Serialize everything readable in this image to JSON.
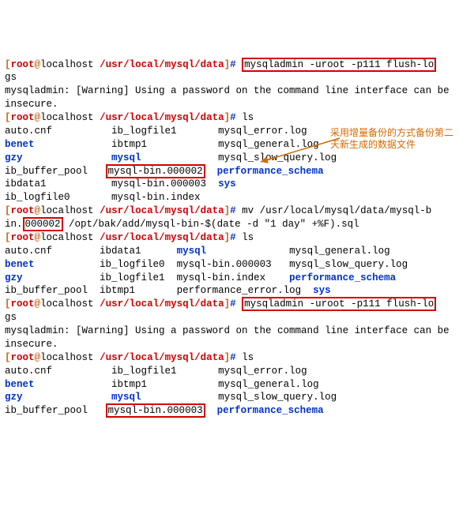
{
  "prompt": {
    "lb": "[",
    "rb": "]",
    "user": "root",
    "at": "@",
    "host": "localhost",
    "path": "/usr/local/mysql/data",
    "hash": "#"
  },
  "cmd1": "mysqladmin -uroot -p111 flush-lo",
  "cmd1b": "gs",
  "warn": "mysqladmin: [Warning] Using a password on the command line interface can be insecure.",
  "cmd2": "ls",
  "ls1": {
    "r1c1": "auto.cnf",
    "r1c2": "ib_logfile1",
    "r1c3": "mysql_error.log",
    "r2c1": "benet",
    "r2c2": "ibtmp1",
    "r2c3": "mysql_general.log",
    "r3c1": "gzy",
    "r3c2": "mysql",
    "r3c3": "mysql_slow_query.log",
    "r4c1": "ib_buffer_pool",
    "r4c2": "mysql-bin.000002",
    "r4c3": "performance_schema",
    "r5c1": "ibdata1",
    "r5c2": "mysql-bin.000003",
    "r5c3": "sys",
    "r6c1": "ib_logfile0",
    "r6c2": "mysql-bin.index"
  },
  "annotation": "采用增量备份的方式备份第二天新生成的数据文件",
  "cmd3a": "mv /usr/local/mysql/data/mysql-b",
  "cmd3b_pre": "in.",
  "cmd3b_box": "000002",
  "cmd3b_post": " /opt/bak/add/mysql-bin-$(date -d \"1 day\" +%F).sql",
  "cmd4": "ls",
  "ls2": {
    "r1c1": "auto.cnf",
    "r1c2": "ibdata1",
    "r1c3": "mysql",
    "r1c4": "mysql_general.log",
    "r2c1": "benet",
    "r2c2": "ib_logfile0",
    "r2c3": "mysql-bin.000003",
    "r2c4": "mysql_slow_query.log",
    "r3c1": "gzy",
    "r3c2": "ib_logfile1",
    "r3c3": "mysql-bin.index",
    "r3c4": "performance_schema",
    "r4c1": "ib_buffer_pool",
    "r4c2": "ibtmp1",
    "r4c3": "performance_error.log",
    "r4c4": "sys"
  },
  "cmd5": "mysqladmin -uroot -p111 flush-lo",
  "cmd5b": "gs",
  "cmd6": "ls",
  "ls3": {
    "r1c1": "auto.cnf",
    "r1c2": "ib_logfile1",
    "r1c3": "mysql_error.log",
    "r2c1": "benet",
    "r2c2": "ibtmp1",
    "r2c3": "mysql_general.log",
    "r3c1": "gzy",
    "r3c2": "mysql",
    "r3c3": "mysql_slow_query.log",
    "r4c1": "ib_buffer_pool",
    "r4c2": "mysql-bin.000003",
    "r4c3": "performance_schema"
  }
}
